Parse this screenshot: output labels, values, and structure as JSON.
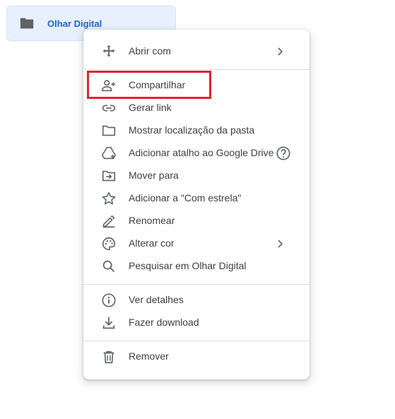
{
  "folder": {
    "name": "Olhar Digital",
    "icon": "folder-icon"
  },
  "highlight_color": "#e0242b",
  "menu": {
    "items": [
      {
        "label": "Abrir com",
        "icon": "open-with-icon",
        "has_submenu": true
      },
      {
        "label": "Compartilhar",
        "icon": "share-person-add-icon"
      },
      {
        "label": "Gerar link",
        "icon": "link-icon"
      },
      {
        "label": "Mostrar localização da pasta",
        "icon": "folder-outline-icon"
      },
      {
        "label": "Adicionar atalho ao Google Drive",
        "icon": "add-shortcut-icon",
        "help_icon": "help-icon"
      },
      {
        "label": "Mover para",
        "icon": "move-to-folder-icon"
      },
      {
        "label": "Adicionar a \"Com estrela\"",
        "icon": "star-icon"
      },
      {
        "label": "Renomear",
        "icon": "pencil-icon"
      },
      {
        "label": "Alterar cor",
        "icon": "palette-icon",
        "has_submenu": true
      },
      {
        "label": "Pesquisar em Olhar Digital",
        "icon": "search-icon"
      },
      {
        "label": "Ver detalhes",
        "icon": "info-icon"
      },
      {
        "label": "Fazer download",
        "icon": "download-icon"
      },
      {
        "label": "Remover",
        "icon": "trash-icon"
      }
    ]
  }
}
